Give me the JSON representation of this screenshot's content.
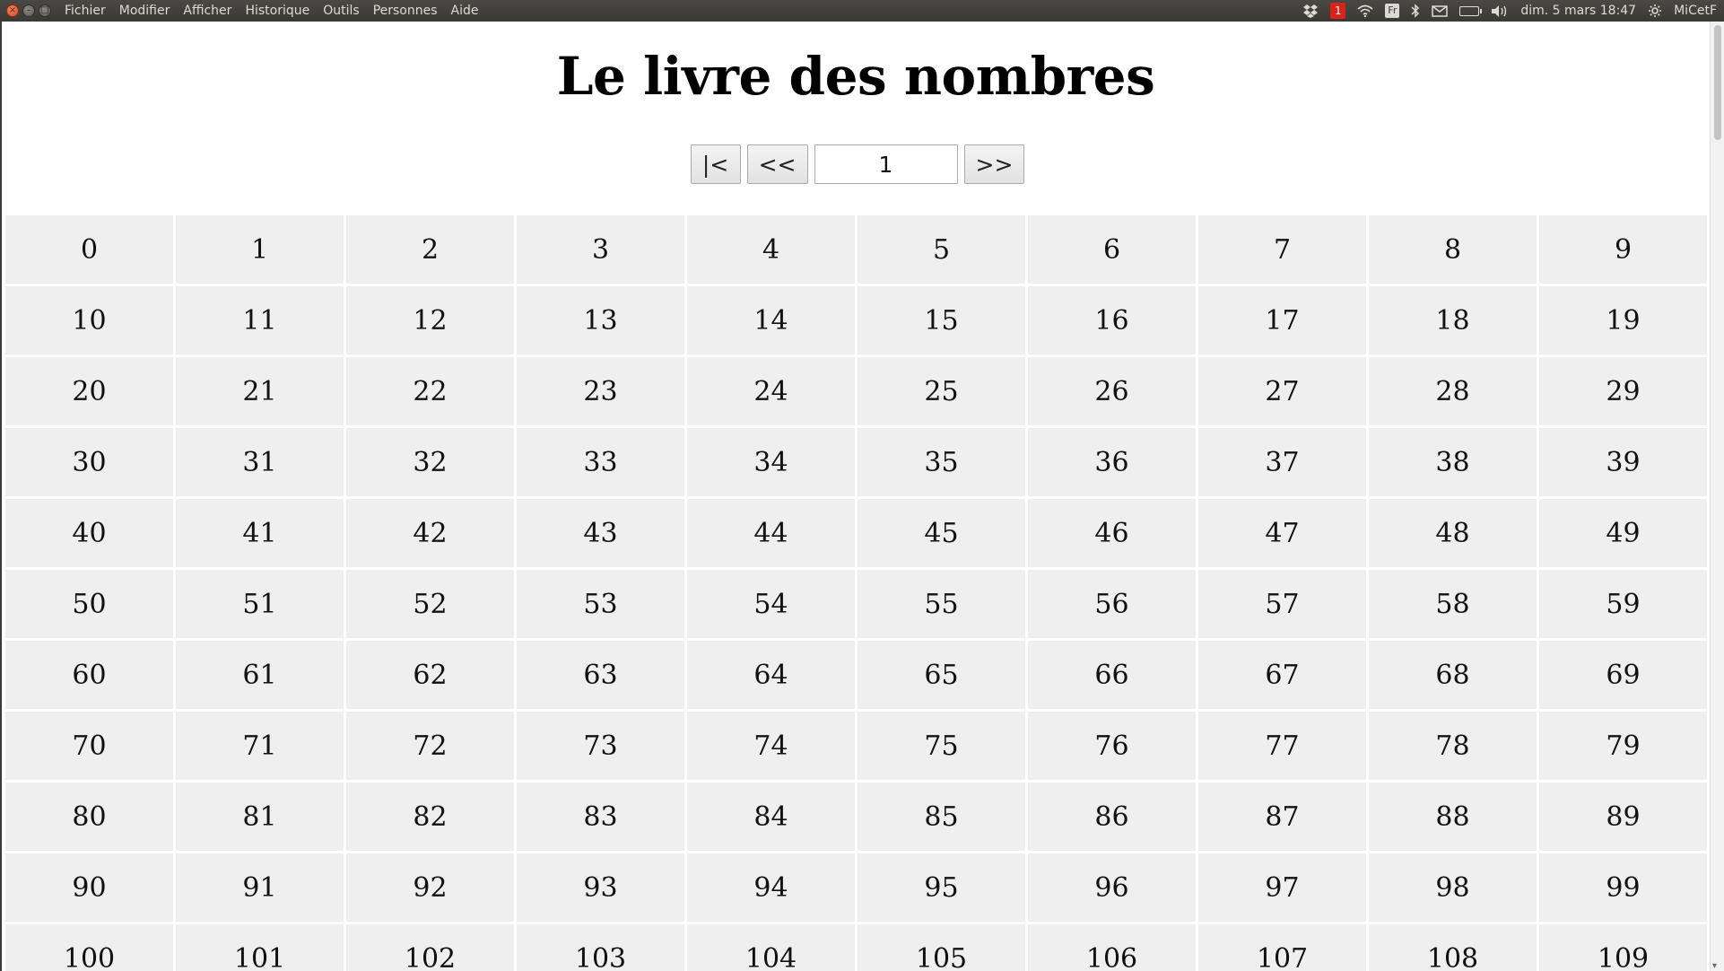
{
  "menubar": {
    "window_controls": {
      "close_label": "×",
      "minimize_label": "–",
      "maximize_label": "□"
    },
    "menus": [
      {
        "label": "Fichier"
      },
      {
        "label": "Modifier"
      },
      {
        "label": "Afficher"
      },
      {
        "label": "Historique"
      },
      {
        "label": "Outils"
      },
      {
        "label": "Personnes"
      },
      {
        "label": "Aide"
      }
    ],
    "tray": {
      "dropbox_icon": "dropbox-icon",
      "notification_count": "1",
      "wifi_icon": "wifi-icon",
      "keyboard_layout": "Fr",
      "bluetooth_icon": "bluetooth-icon",
      "mail_icon": "mail-icon",
      "battery_icon": "battery-icon",
      "volume_icon": "volume-icon",
      "datetime": "dim. 5 mars 18:47",
      "settings_icon": "gear-icon",
      "user": "MiCetF"
    }
  },
  "page": {
    "title": "Le livre des nombres",
    "pager": {
      "first_label": "|<",
      "prev_label": "<<",
      "current_page": "1",
      "next_label": ">>"
    },
    "numbers": [
      [
        "0",
        "1",
        "2",
        "3",
        "4",
        "5",
        "6",
        "7",
        "8",
        "9"
      ],
      [
        "10",
        "11",
        "12",
        "13",
        "14",
        "15",
        "16",
        "17",
        "18",
        "19"
      ],
      [
        "20",
        "21",
        "22",
        "23",
        "24",
        "25",
        "26",
        "27",
        "28",
        "29"
      ],
      [
        "30",
        "31",
        "32",
        "33",
        "34",
        "35",
        "36",
        "37",
        "38",
        "39"
      ],
      [
        "40",
        "41",
        "42",
        "43",
        "44",
        "45",
        "46",
        "47",
        "48",
        "49"
      ],
      [
        "50",
        "51",
        "52",
        "53",
        "54",
        "55",
        "56",
        "57",
        "58",
        "59"
      ],
      [
        "60",
        "61",
        "62",
        "63",
        "64",
        "65",
        "66",
        "67",
        "68",
        "69"
      ],
      [
        "70",
        "71",
        "72",
        "73",
        "74",
        "75",
        "76",
        "77",
        "78",
        "79"
      ],
      [
        "80",
        "81",
        "82",
        "83",
        "84",
        "85",
        "86",
        "87",
        "88",
        "89"
      ],
      [
        "90",
        "91",
        "92",
        "93",
        "94",
        "95",
        "96",
        "97",
        "98",
        "99"
      ],
      [
        "100",
        "101",
        "102",
        "103",
        "104",
        "105",
        "106",
        "107",
        "108",
        "109"
      ]
    ]
  },
  "colors": {
    "menubar_bg": "#3c3b37",
    "menubar_text": "#dfdbd2",
    "cell_bg": "#efefef",
    "notification_badge": "#d8221a"
  }
}
